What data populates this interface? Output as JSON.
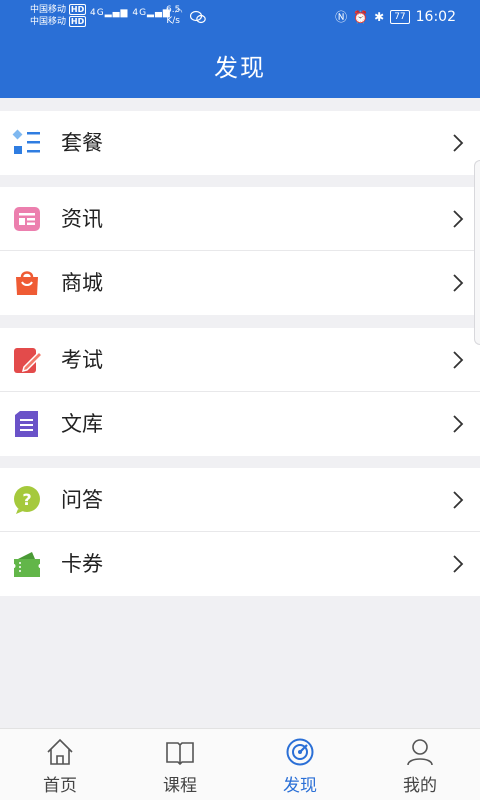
{
  "status_bar": {
    "carrier_1": "中国移动",
    "carrier_2": "中国移动",
    "hd_badge": "HD",
    "network_1": "4G",
    "network_2": "4G",
    "speed_value": "6.5",
    "speed_unit": "K/s",
    "battery": "77",
    "time": "16:02"
  },
  "header": {
    "title": "发现"
  },
  "groups": [
    {
      "items": [
        {
          "label": "套餐",
          "icon": "package-icon",
          "color": "#2f7de1"
        }
      ]
    },
    {
      "items": [
        {
          "label": "资讯",
          "icon": "news-icon",
          "color": "#e66fa3"
        },
        {
          "label": "商城",
          "icon": "shopping-bag-icon",
          "color": "#ef5b34"
        }
      ]
    },
    {
      "items": [
        {
          "label": "考试",
          "icon": "exam-pencil-icon",
          "color": "#e34b4b"
        },
        {
          "label": "文库",
          "icon": "document-library-icon",
          "color": "#6a52c8"
        }
      ]
    },
    {
      "items": [
        {
          "label": "问答",
          "icon": "question-bubble-icon",
          "color": "#a5c93c"
        },
        {
          "label": "卡券",
          "icon": "ticket-icon",
          "color": "#62b649"
        }
      ]
    }
  ],
  "tabbar": {
    "tabs": [
      {
        "label": "首页",
        "icon": "home-icon",
        "active": false
      },
      {
        "label": "课程",
        "icon": "book-icon",
        "active": false
      },
      {
        "label": "发现",
        "icon": "discover-icon",
        "active": true
      },
      {
        "label": "我的",
        "icon": "user-icon",
        "active": false
      }
    ],
    "active_color": "#2a6fd6"
  },
  "colors": {
    "header_bg": "#2a6fd6",
    "page_bg": "#f0f0f3"
  }
}
